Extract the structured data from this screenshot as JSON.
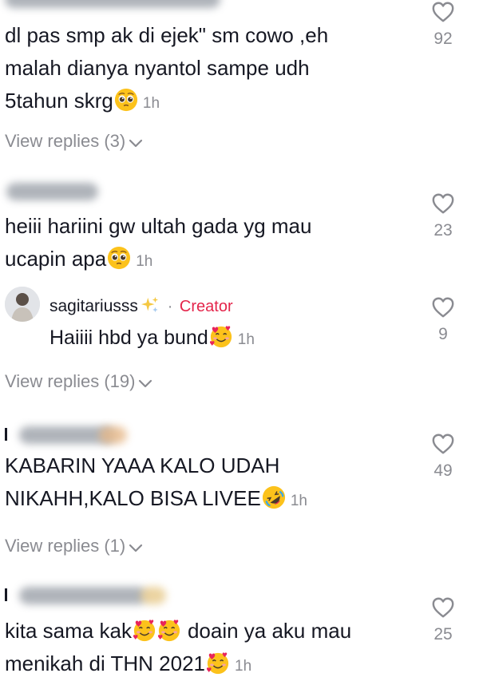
{
  "comments": [
    {
      "lines": [
        "dl pas smp ak di ejek\" sm cowo ,eh",
        "malah dianya nyantol sampe udh",
        "5tahun skrg"
      ],
      "emoji": "pleading-face",
      "time": "1h",
      "likes": "92",
      "view_replies": "View replies (3)"
    },
    {
      "lines": [
        "heiii hariini gw ultah gada yg mau",
        "ucapin apa"
      ],
      "emoji": "pleading-face",
      "time": "1h",
      "likes": "23",
      "reply": {
        "username": "sagitariusss",
        "sparkle": "sparkles",
        "separator": "·",
        "badge": "Creator",
        "text": "Haiiii hbd ya bund",
        "emoji": "smiling-face-with-hearts",
        "time": "1h",
        "likes": "9"
      },
      "view_replies": "View replies (19)"
    },
    {
      "lines": [
        "KABARIN YAAA KALO UDAH",
        "NIKAHH,KALO BISA LIVEE"
      ],
      "emoji": "rolling-on-floor-laughing",
      "time": "1h",
      "likes": "49",
      "view_replies": "View replies (1)"
    },
    {
      "lines": [
        "kita sama kak",
        "menikah di THN 2021"
      ],
      "line1_suffix": "doain ya aku mau",
      "emoji": "smiling-face-with-hearts",
      "time": "1h",
      "likes": "25"
    }
  ],
  "colors": {
    "text": "#161823",
    "muted": "#8a8b91",
    "creator": "#e4254b"
  }
}
